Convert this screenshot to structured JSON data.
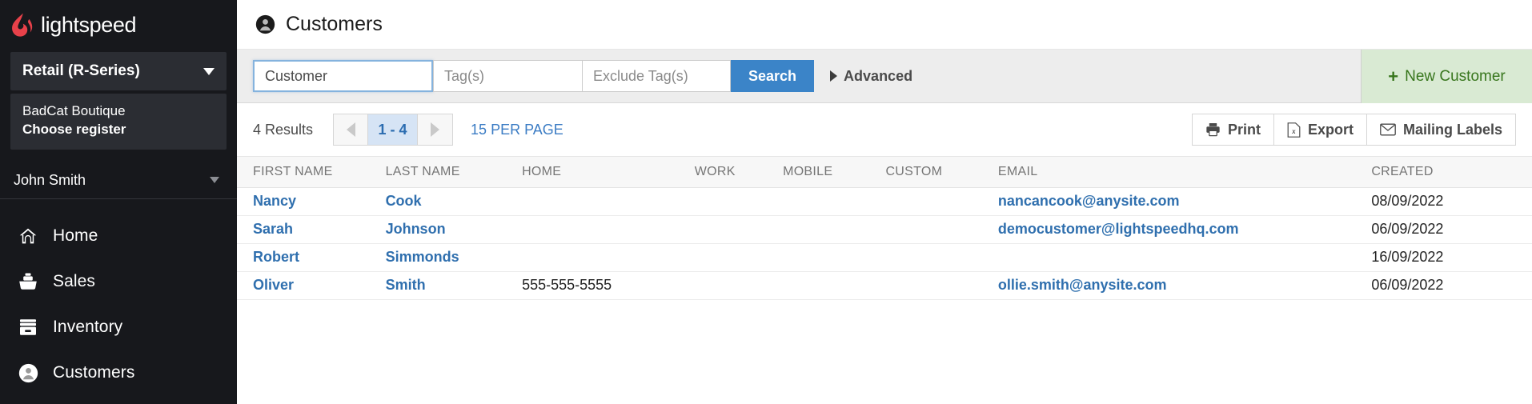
{
  "sidebar": {
    "logo_text": "lightspeed",
    "series_select": {
      "label": "Retail (R-Series)",
      "caret": "chevron-down-icon"
    },
    "store": {
      "name": "BadCat Boutique",
      "register": "Choose register"
    },
    "user": {
      "name": "John Smith",
      "caret": "chevron-down-icon"
    },
    "nav_items": [
      {
        "label": "Home",
        "icon": "home-icon"
      },
      {
        "label": "Sales",
        "icon": "sales-register-icon"
      },
      {
        "label": "Inventory",
        "icon": "inventory-box-icon"
      },
      {
        "label": "Customers",
        "icon": "customers-person-icon"
      }
    ]
  },
  "header": {
    "title": "Customers",
    "icon": "customers-person-icon"
  },
  "search": {
    "customer_value": "Customer",
    "customer_placeholder": "Customer",
    "tags_placeholder": "Tag(s)",
    "exclude_tags_placeholder": "Exclude Tag(s)",
    "search_button": "Search",
    "advanced_label": "Advanced",
    "new_customer_label": "New Customer",
    "new_customer_plus": "+"
  },
  "toolbar": {
    "results_count": "4 Results",
    "page_range": "1 - 4",
    "per_page": "15 PER PAGE",
    "print_label": "Print",
    "export_label": "Export",
    "mailing_labels_label": "Mailing Labels"
  },
  "table": {
    "columns": [
      {
        "key": "first_name",
        "label": "FIRST NAME"
      },
      {
        "key": "last_name",
        "label": "LAST NAME"
      },
      {
        "key": "home",
        "label": "HOME"
      },
      {
        "key": "work",
        "label": "WORK"
      },
      {
        "key": "mobile",
        "label": "MOBILE"
      },
      {
        "key": "custom",
        "label": "CUSTOM"
      },
      {
        "key": "email",
        "label": "EMAIL"
      },
      {
        "key": "created",
        "label": "CREATED"
      }
    ],
    "rows": [
      {
        "first_name": "Nancy",
        "last_name": "Cook",
        "home": "",
        "work": "",
        "mobile": "",
        "custom": "",
        "email": "nancancook@anysite.com",
        "created": "08/09/2022"
      },
      {
        "first_name": "Sarah",
        "last_name": "Johnson",
        "home": "",
        "work": "",
        "mobile": "",
        "custom": "",
        "email": "democustomer@lightspeedhq.com",
        "created": "06/09/2022"
      },
      {
        "first_name": "Robert",
        "last_name": "Simmonds",
        "home": "",
        "work": "",
        "mobile": "",
        "custom": "",
        "email": "",
        "created": "16/09/2022"
      },
      {
        "first_name": "Oliver",
        "last_name": "Smith",
        "home": "555-555-5555",
        "work": "",
        "mobile": "",
        "custom": "",
        "email": "ollie.smith@anysite.com",
        "created": "06/09/2022"
      }
    ]
  },
  "colors": {
    "sidebar_bg": "#17181c",
    "logo_red": "#e8414a",
    "primary_blue": "#3b84c8",
    "link_blue": "#2f6fae",
    "new_customer_bg": "#d9ead3",
    "new_customer_text": "#38761d",
    "search_bar_bg": "#ededed",
    "pager_active_bg": "#d6e4f5"
  }
}
